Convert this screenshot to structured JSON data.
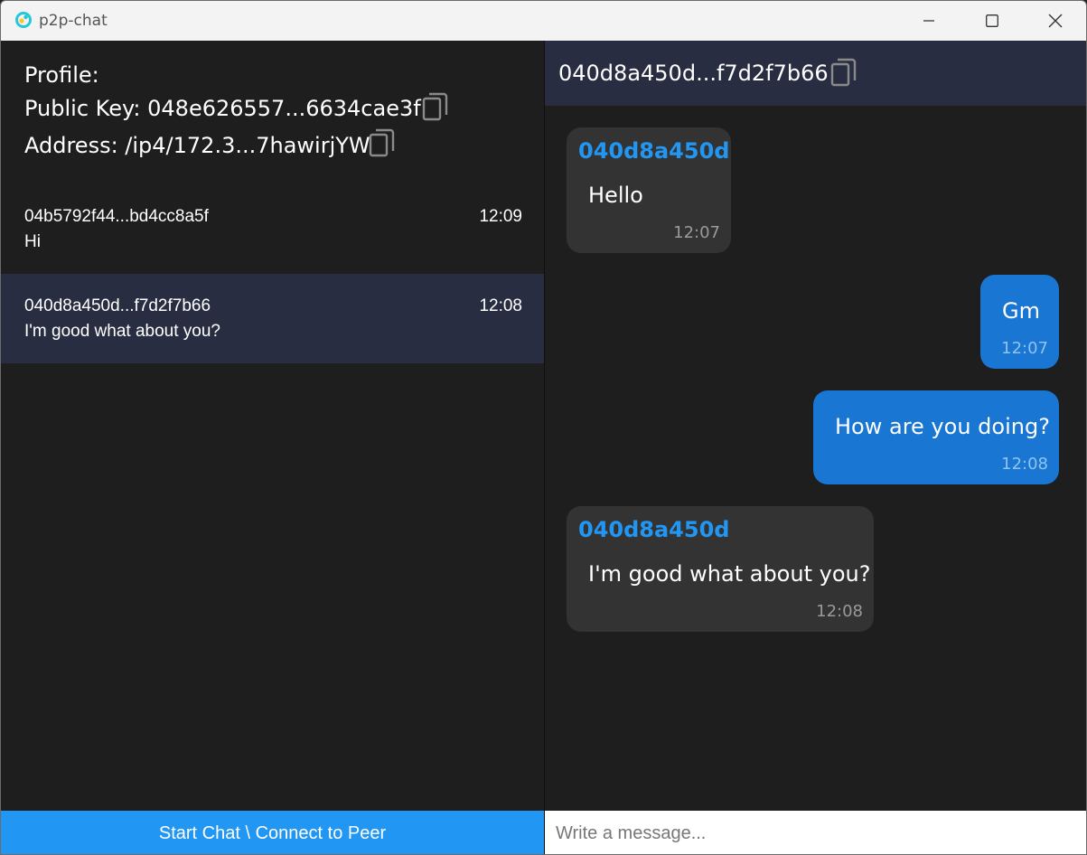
{
  "window": {
    "title": "p2p-chat"
  },
  "profile": {
    "heading": "Profile:",
    "public_key_line": "Public Key: 048e626557...6634cae3f",
    "address_line": "Address: /ip4/172.3...7hawirjYW"
  },
  "chats": [
    {
      "name": "04b5792f44...bd4cc8a5f",
      "time": "12:09",
      "last_message": "Hi",
      "active": false
    },
    {
      "name": "040d8a450d...f7d2f7b66",
      "time": "12:08",
      "last_message": "I'm good what about you?",
      "active": true
    }
  ],
  "start_chat_label": "Start Chat \\ Connect to Peer",
  "conversation": {
    "header_title": "040d8a450d...f7d2f7b66",
    "messages": [
      {
        "direction": "incoming",
        "sender": "040d8a450d",
        "text": "Hello",
        "time": "12:07"
      },
      {
        "direction": "outgoing",
        "text": "Gm",
        "time": "12:07"
      },
      {
        "direction": "outgoing",
        "text": "How are you doing?",
        "time": "12:08"
      },
      {
        "direction": "incoming",
        "sender": "040d8a450d",
        "text": "I'm good what about you?",
        "time": "12:08"
      }
    ]
  },
  "composer": {
    "placeholder": "Write a message..."
  },
  "colors": {
    "accent": "#2196f3",
    "outgoing_bubble": "#1976d2",
    "incoming_bubble": "#333333",
    "header_bg": "#292d42",
    "background": "#1e1e1e"
  },
  "icons": {
    "app": "app-logo-icon",
    "copy": "copy-icon",
    "minimize": "minimize-icon",
    "maximize": "maximize-icon",
    "close": "close-icon"
  }
}
